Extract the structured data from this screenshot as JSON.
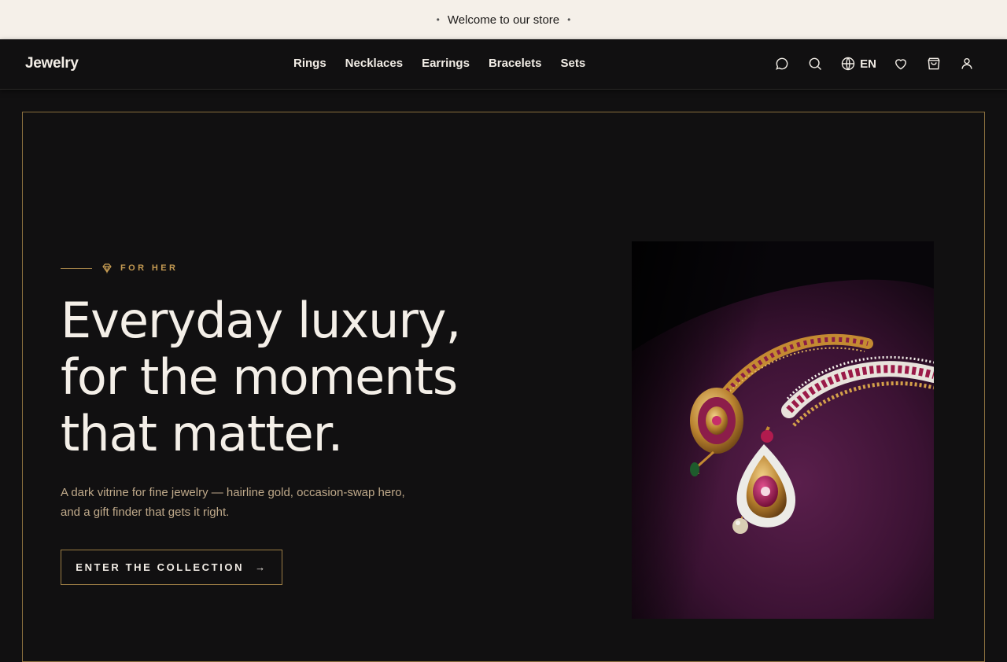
{
  "announcement": {
    "text": "Welcome to our store",
    "bullet": "•"
  },
  "header": {
    "logo": "Jewelry",
    "nav": [
      "Rings",
      "Necklaces",
      "Earrings",
      "Bracelets",
      "Sets"
    ],
    "language": "EN",
    "icons": [
      "chat-icon",
      "search-icon",
      "globe-icon",
      "heart-icon",
      "cart-icon",
      "user-icon"
    ]
  },
  "hero": {
    "eyebrow": "FOR HER",
    "headline_lines": [
      "Everyday luxury,",
      "for the moments",
      "that matter."
    ],
    "subcopy": "A dark vitrine for fine jewelry — hairline gold, occasion-swap hero, and a gift finder that gets it right.",
    "cta_label": "ENTER THE COLLECTION",
    "cta_arrow": "→"
  },
  "colors": {
    "background": "#111011",
    "announcement_bg": "#f5f0e9",
    "gold_accent": "#c49a52",
    "frame_border": "#8a6f3e",
    "text_light": "#f4efe8",
    "subcopy": "#bfa98a"
  }
}
